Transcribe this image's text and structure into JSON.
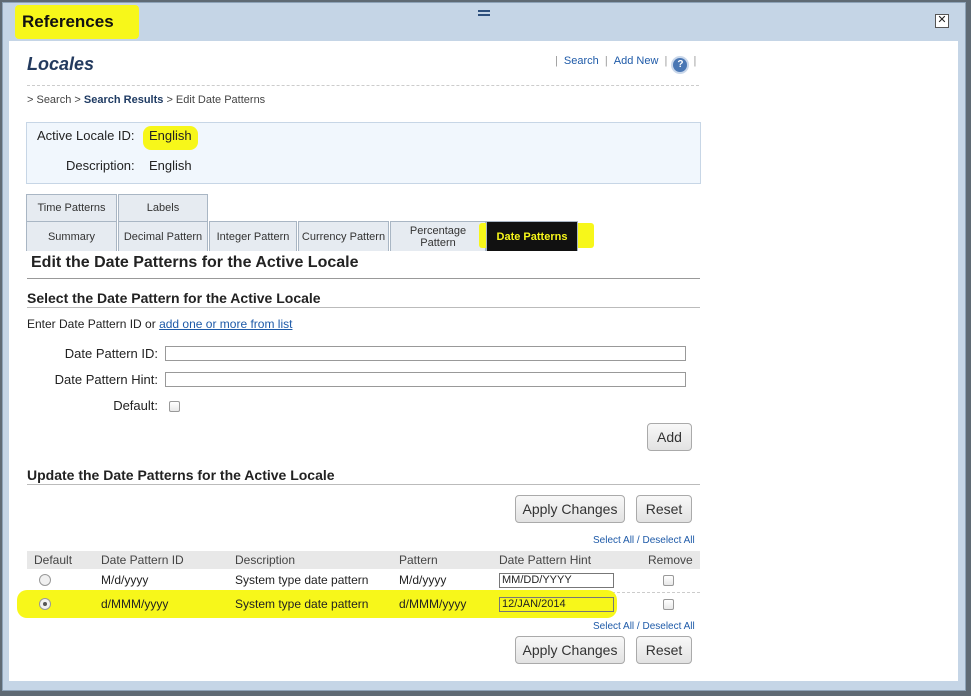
{
  "dialog": {
    "title": "References",
    "close_symbol": "✕"
  },
  "header": {
    "title": "Locales",
    "links": {
      "search": "Search",
      "add_new": "Add New"
    },
    "help_symbol": "?"
  },
  "breadcrumb": {
    "prefix": "> Search >",
    "current_link": "Search Results",
    "suffix": "> Edit Date Patterns"
  },
  "locale": {
    "active_label": "Active Locale ID:",
    "active_value": "English",
    "description_label": "Description:",
    "description_value": "English"
  },
  "tabs": {
    "row1": [
      "Time Patterns",
      "Labels"
    ],
    "row2": [
      "Summary",
      "Decimal Pattern",
      "Integer Pattern",
      "Currency Pattern",
      "Percentage Pattern",
      "Date Patterns"
    ],
    "active": "Date Patterns"
  },
  "edit_heading": "Edit the Date Patterns for the Active Locale",
  "select_section": {
    "heading": "Select the Date Pattern for the Active Locale",
    "intro_text": "Enter Date Pattern ID or",
    "intro_link": "add one or more from list",
    "id_label": "Date Pattern ID:",
    "id_value": "",
    "hint_label": "Date Pattern Hint:",
    "hint_value": "",
    "default_label": "Default:",
    "default_checked": false,
    "add_button": "Add"
  },
  "update_section": {
    "heading": "Update the Date Patterns for the Active Locale",
    "apply_button": "Apply Changes",
    "reset_button": "Reset",
    "select_all": "Select All",
    "separator": "/",
    "deselect_all": "Deselect All",
    "columns": [
      "Default",
      "Date Pattern ID",
      "Description",
      "Pattern",
      "Date Pattern Hint",
      "Remove"
    ],
    "rows": [
      {
        "default": false,
        "id": "M/d/yyyy",
        "description": "System type date pattern",
        "pattern": "M/d/yyyy",
        "hint": "MM/DD/YYYY",
        "remove": false
      },
      {
        "default": true,
        "id": "d/MMM/yyyy",
        "description": "System type date pattern",
        "pattern": "d/MMM/yyyy",
        "hint": "12/JAN/2014",
        "remove": false
      }
    ]
  },
  "colors": {
    "highlight": "#f7f71a",
    "link": "#1e5aa8",
    "active_tab_bg": "#111111"
  }
}
